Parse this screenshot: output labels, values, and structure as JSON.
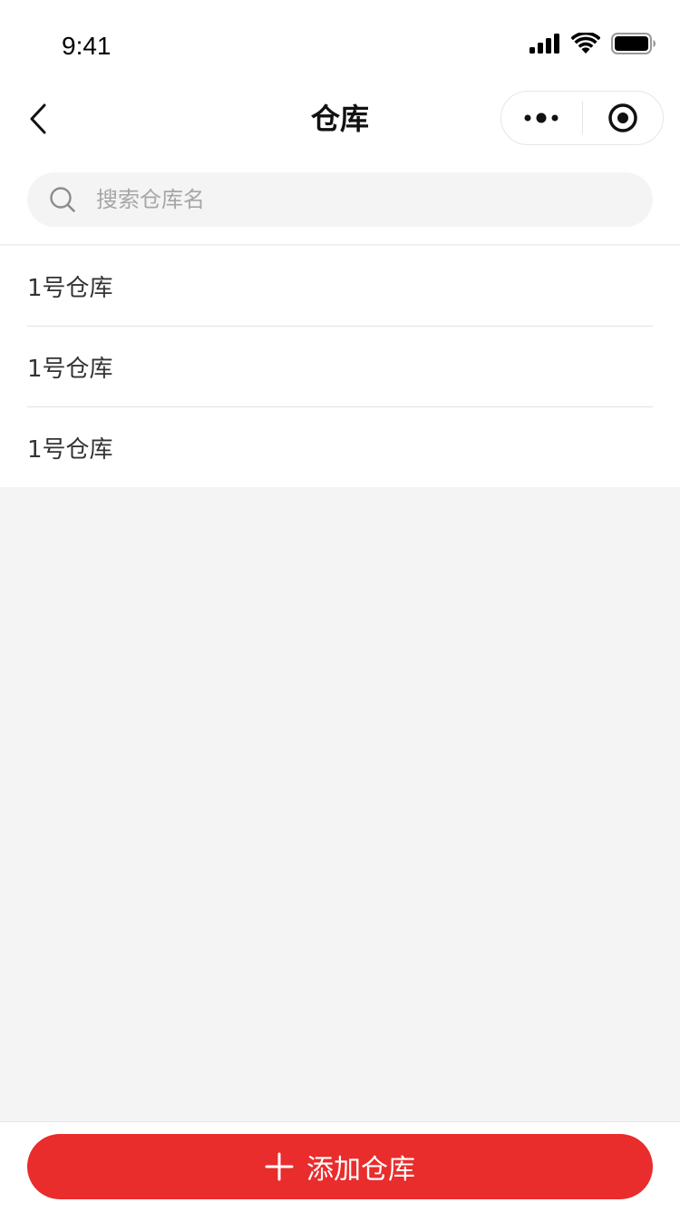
{
  "status_bar": {
    "time": "9:41",
    "icons": [
      "signal-icon",
      "wifi-icon",
      "battery-icon"
    ]
  },
  "nav": {
    "title": "仓库",
    "back_icon": "chevron-left-icon",
    "menu_icon": "more-dots-icon",
    "close_icon": "target-circle-icon"
  },
  "search": {
    "placeholder": "搜索仓库名",
    "value": "",
    "icon": "search-icon"
  },
  "warehouses": [
    {
      "name": "1号仓库"
    },
    {
      "name": "1号仓库"
    },
    {
      "name": "1号仓库"
    }
  ],
  "footer": {
    "add_label": "添加仓库",
    "add_icon": "plus-icon"
  },
  "colors": {
    "accent": "#e92c2c",
    "background": "#f4f4f4",
    "surface": "#ffffff",
    "text_primary": "#333333",
    "placeholder": "#a6a6a6"
  }
}
